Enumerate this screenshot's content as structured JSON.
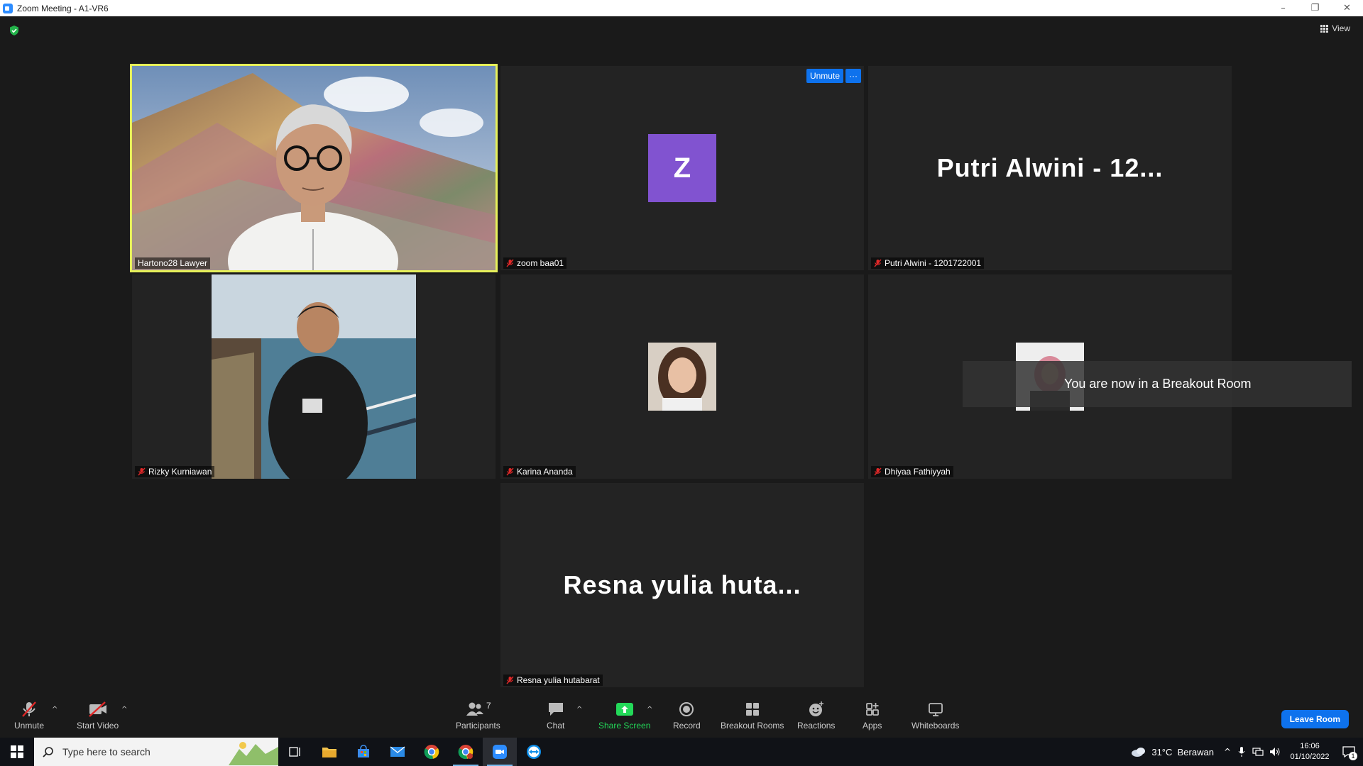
{
  "window": {
    "title": "Zoom Meeting - A1-VR6",
    "min": "–",
    "max": "❐",
    "close": "✕"
  },
  "topbar": {
    "view_label": "View"
  },
  "tiles": [
    {
      "name": "Hartono28 Lawyer",
      "type": "video",
      "muted": false,
      "active_speaker": true
    },
    {
      "name": "zoom baa01",
      "type": "initial",
      "initial": "Z",
      "muted": true,
      "avatar_color": "#8153d0"
    },
    {
      "name": "Putri Alwini - 1201722001",
      "type": "bigname",
      "display": "Putri Alwini - 12...",
      "muted": true
    },
    {
      "name": "Rizky Kurniawan",
      "type": "video",
      "muted": true
    },
    {
      "name": "Karina Ananda",
      "type": "photo",
      "muted": true
    },
    {
      "name": "Dhiyaa Fathiyyah",
      "type": "photo",
      "muted": true
    },
    {
      "name": "Resna yulia hutabarat",
      "type": "bigname",
      "display": "Resna yulia huta...",
      "muted": true
    }
  ],
  "tile_overlay": {
    "unmute_label": "Unmute",
    "more_label": "···"
  },
  "toast": "You are now in a Breakout Room",
  "toolbar": {
    "unmute": "Unmute",
    "start_video": "Start Video",
    "participants": "Participants",
    "participants_count": "7",
    "chat": "Chat",
    "share_screen": "Share Screen",
    "record": "Record",
    "breakout_rooms": "Breakout Rooms",
    "reactions": "Reactions",
    "apps": "Apps",
    "whiteboards": "Whiteboards",
    "leave": "Leave Room"
  },
  "taskbar": {
    "search_placeholder": "Type here to search",
    "weather": "31°C  Berawan",
    "time": "16:06",
    "date": "01/10/2022",
    "notification_count": "1"
  },
  "colors": {
    "accent": "#0e72ed",
    "share_green": "#23d959",
    "active_border": "#e6f05a",
    "muted_red": "#e02828"
  }
}
